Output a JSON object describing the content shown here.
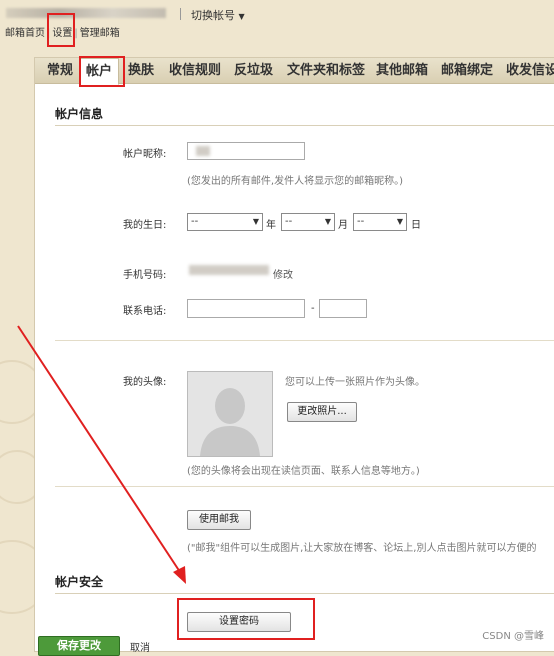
{
  "header": {
    "switch_account": "切换帐号",
    "links": [
      "邮箱首页",
      "设置",
      "管理邮箱"
    ]
  },
  "tabs": [
    "常规",
    "帐户",
    "换肤",
    "收信规则",
    "反垃圾",
    "文件夹和标签",
    "其他邮箱",
    "邮箱绑定",
    "收发信设"
  ],
  "active_tab": "帐户",
  "account_info": {
    "section_title": "帐户信息",
    "nickname_label": "帐户昵称:",
    "nickname_hint": "(您发出的所有邮件,发件人将显示您的邮箱昵称。)",
    "birthday_label": "我的生日:",
    "birthday_year": "--",
    "birthday_month": "--",
    "birthday_day": "--",
    "year_unit": "年",
    "month_unit": "月",
    "day_unit": "日",
    "phone_label": "手机号码:",
    "phone_modify": "修改",
    "tel_label": "联系电话:",
    "tel_dash": "-",
    "avatar_label": "我的头像:",
    "avatar_hint": "您可以上传一张照片作为头像。",
    "change_photo": "更改照片...",
    "avatar_note": "(您的头像将会出现在读信页面、联系人信息等地方。)",
    "use_mail_me": "使用邮我",
    "mail_me_note": "(\"邮我\"组件可以生成图片,让大家放在博客、论坛上,別人点击图片就可以方便的"
  },
  "security": {
    "section_title": "帐户安全",
    "set_password": "设置密码"
  },
  "footer": {
    "save": "保存更改",
    "cancel": "取消"
  },
  "watermark": "CSDN @雪峰",
  "colors": {
    "highlight": "#e02020",
    "save_button": "#4d9a3a",
    "background": "#efe6cf"
  }
}
